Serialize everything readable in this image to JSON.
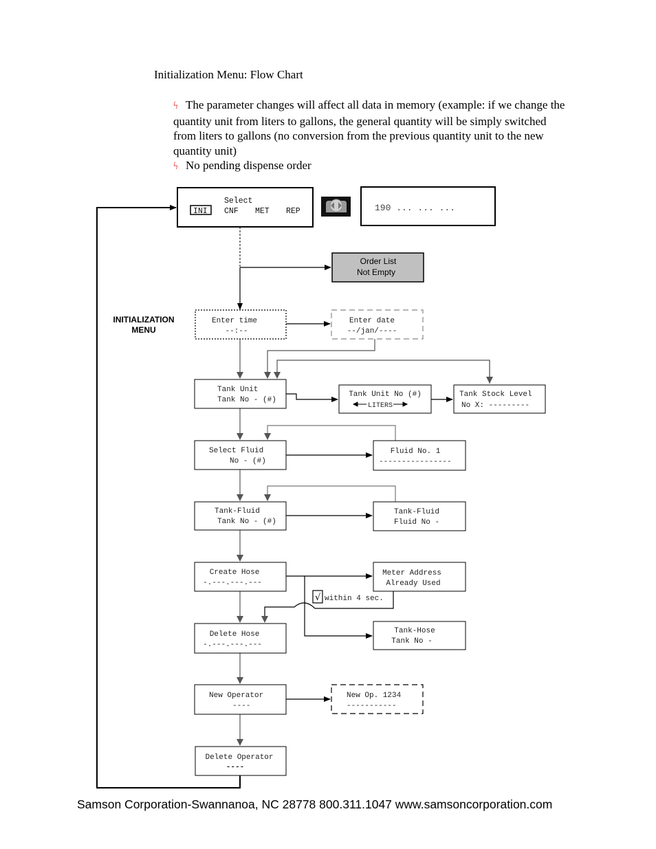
{
  "document": {
    "title": "Initialization Menu: Flow Chart",
    "notes": [
      "The parameter changes will affect all data in memory (example: if we change the quantity unit from liters to gallons, the general quantity will be simply switched from liters to gallons (no conversion from the previous quantity unit to the new quantity unit)",
      "No pending dispense order"
    ],
    "note_bullet_icon": "red-lightning-bolt-icon",
    "side_label": [
      "INITIALIZATION",
      "MENU"
    ],
    "footer": "Samson Corporation-Swannanoa, NC 28778  800.311.1047 www.samsoncorporation.com"
  },
  "colors": {
    "bullet": "#e01010",
    "warning_box_fill": "#c0c0c0",
    "connector_gray": "#555555",
    "connector_black": "#000000"
  },
  "flowchart": {
    "select_menu": {
      "title": "Select",
      "options": [
        "INI",
        "CNF",
        "MET",
        "REP"
      ],
      "selected": "INI"
    },
    "nav_key_icon": "left-right-arrow-key-icon",
    "display_readout": "190 ... ... ...",
    "order_warning": [
      "Order List",
      "Not Empty"
    ],
    "enter_time": [
      "Enter time",
      "--:--"
    ],
    "enter_date": [
      "Enter date",
      "--/jan/----"
    ],
    "tank_unit": [
      "Tank Unit",
      "Tank No - (#)"
    ],
    "tank_unit_no": [
      "Tank Unit No (#)",
      "LITERS"
    ],
    "tank_stock_level": [
      "Tank Stock Level",
      "No X: ---------"
    ],
    "select_fluid": [
      "Select Fluid",
      "No - (#)"
    ],
    "fluid_no": [
      "Fluid No. 1",
      "----------------"
    ],
    "tank_fluid": [
      "Tank-Fluid",
      "Tank No - (#)"
    ],
    "tank_fluid_detail": [
      "Tank-Fluid",
      "Fluid No -"
    ],
    "create_hose": [
      "Create Hose",
      "-.---.---.---"
    ],
    "meter_address": [
      "Meter Address",
      "Already Used"
    ],
    "confirm_check": "√",
    "confirm_label": "within 4 sec.",
    "delete_hose": [
      "Delete Hose",
      "-.---.---.---"
    ],
    "tank_hose": [
      "Tank-Hose",
      "Tank No -"
    ],
    "new_operator": [
      "New Operator",
      "----"
    ],
    "new_op_detail": [
      "New Op. 1234",
      "-----------"
    ],
    "delete_operator": [
      "Delete Operator",
      "----"
    ]
  }
}
